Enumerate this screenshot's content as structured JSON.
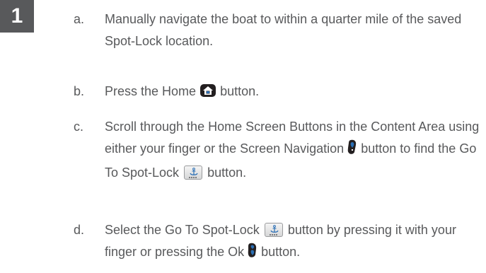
{
  "step_number": "1",
  "steps": [
    {
      "letter": "a.",
      "text": "Manually navigate the boat to within a quarter mile of the saved Spot-Lock location."
    },
    {
      "letter": "b.",
      "before": "Press the Home",
      "after": "button.",
      "icon": "home-icon"
    },
    {
      "letter": "c.",
      "part1": "Scroll through the Home Screen Buttons in the Content Area using either your finger or the Screen Navigation",
      "part2": "button to find the Go To Spot-Lock",
      "part3": "button.",
      "icons": [
        "screen-navigation-icon",
        "spot-lock-button-icon"
      ]
    },
    {
      "letter": "d.",
      "part1": "Select the Go To Spot-Lock",
      "part2": "button by pressing it with your finger or pressing the Ok",
      "part3": "button.",
      "icons": [
        "spot-lock-button-icon",
        "ok-button-icon"
      ]
    }
  ],
  "colors": {
    "text": "#58595b",
    "badge_bg": "#58595b",
    "badge_text": "#ffffff",
    "icon_dark": "#231f20",
    "icon_blue": "#2a6fb5"
  }
}
